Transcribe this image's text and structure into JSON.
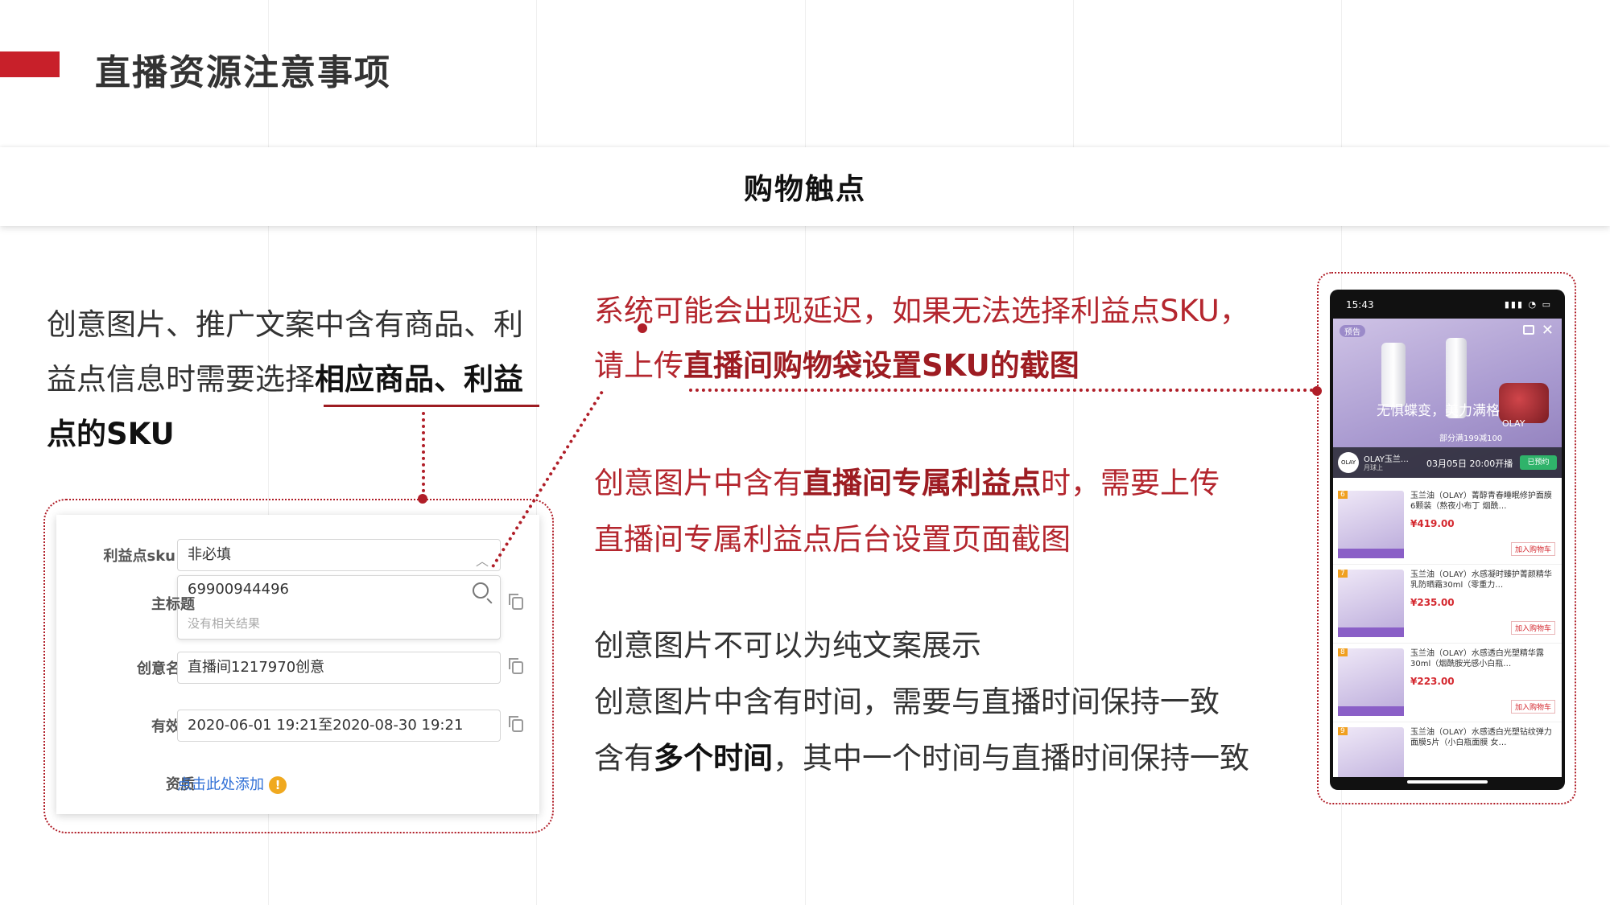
{
  "header": {
    "title": "直播资源注意事项"
  },
  "section": {
    "title": "购物触点"
  },
  "left": {
    "line1": "创意图片、推广文案中含有商品、利",
    "line2_pre": "益点信息时需要选择",
    "line2_bold": "相应商品、利益",
    "line3_bold": "点的SKU"
  },
  "form": {
    "sku_label": "利益点sku",
    "sku_value": "非必填",
    "title_label": "主标题",
    "search_value": "69900944496",
    "search_empty": "没有相关结果",
    "name_label": "创意名称",
    "name_value": "直播间1217970创意",
    "period_label": "有效期",
    "period_value": "2020-06-01 19:21至2020-08-30 19:21",
    "qual_label": "资质",
    "qual_link": "点击此处添加",
    "warn_glyph": "!"
  },
  "middle": {
    "p1_line1": "系统可能会出现延迟，如果无法选择利益点SKU，",
    "p1_line2_pre": "请上传",
    "p1_line2_bold": "直播间购物袋设置SKU的截图",
    "p2_line1_pre": "创意图片中含有",
    "p2_line1_bold": "直播间专属利益点",
    "p2_line1_post": "时，需要上传",
    "p2_line2": "直播间专属利益点后台设置页面截图",
    "p3_line1": "创意图片不可以为纯文案展示",
    "p3_line2": "创意图片中含有时间，需要与直播时间保持一致",
    "p3_line3_pre": "含有",
    "p3_line3_bold": "多个时间",
    "p3_line3_post": "，其中一个时间与直播时间保持一致"
  },
  "phone": {
    "time": "15:43",
    "signal": "▮▮▮ ◔ ▭",
    "badge": "预告",
    "close": "✕",
    "slogan": "无惧蝶变，美力满格",
    "promo": "部分满199减100",
    "brand_text": "OLAY",
    "logo": "OLAY",
    "shop_name": "OLAY玉兰…",
    "shop_sub": "月球上",
    "live_time": "03月05日 20:00开播",
    "subscribe": "已预约",
    "items": [
      {
        "idx": "6",
        "name": "玉兰油（OLAY）菁醇青春睡眠修护面膜6颗装（熬夜小布丁 烟酰…",
        "price": "¥419.00",
        "cart": "加入购物车"
      },
      {
        "idx": "7",
        "name": "玉兰油（OLAY）水感凝时臻护菁颜精华乳防晒霜30ml（零重力…",
        "price": "¥235.00",
        "cart": "加入购物车"
      },
      {
        "idx": "8",
        "name": "玉兰油（OLAY）水感透白光塑精华露 30ml（烟酰胺光感小白瓶…",
        "price": "¥223.00",
        "cart": "加入购物车"
      },
      {
        "idx": "9",
        "name": "玉兰油（OLAY）水感透白光塑钻纹弹力面膜5片（小白瓶面膜 女…",
        "price": "",
        "cart": ""
      }
    ]
  },
  "colors": {
    "accent": "#c8202a",
    "emphasis": "#9d1c22",
    "link": "#2f6fd6"
  }
}
